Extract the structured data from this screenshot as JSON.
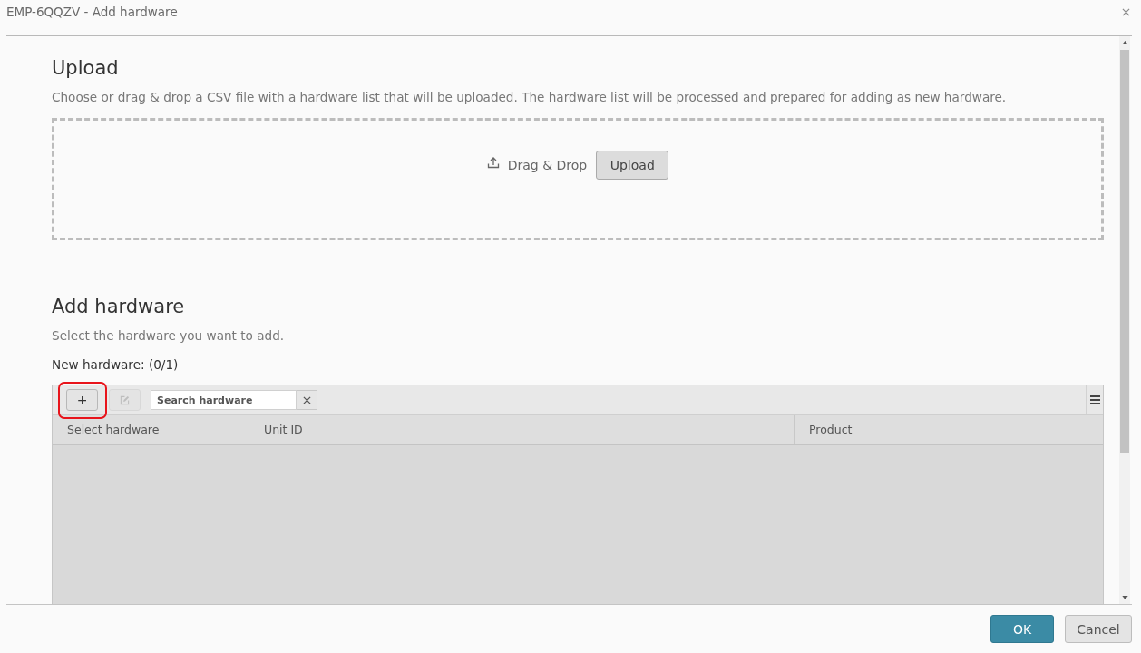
{
  "window": {
    "title": "EMP-6QQZV - Add hardware"
  },
  "upload": {
    "heading": "Upload",
    "description": "Choose or drag & drop a CSV file with a hardware list that will be uploaded. The hardware list will be processed and prepared for adding as new hardware.",
    "drop_label": "Drag & Drop",
    "button": "Upload"
  },
  "add_hardware": {
    "heading": "Add hardware",
    "description": "Select the hardware you want to add.",
    "count_label": "New hardware: (0/1)"
  },
  "grid": {
    "toolbar": {
      "add_button": {
        "label": "+",
        "highlighted": true
      },
      "edit_button": {
        "disabled": true
      },
      "search": {
        "placeholder": "Search hardware"
      }
    },
    "columns": [
      "Select hardware",
      "Unit ID",
      "Product"
    ]
  },
  "footer": {
    "buttons": [
      {
        "label": "OK",
        "kind": "primary"
      },
      {
        "label": "Cancel",
        "kind": "secondary"
      }
    ]
  }
}
